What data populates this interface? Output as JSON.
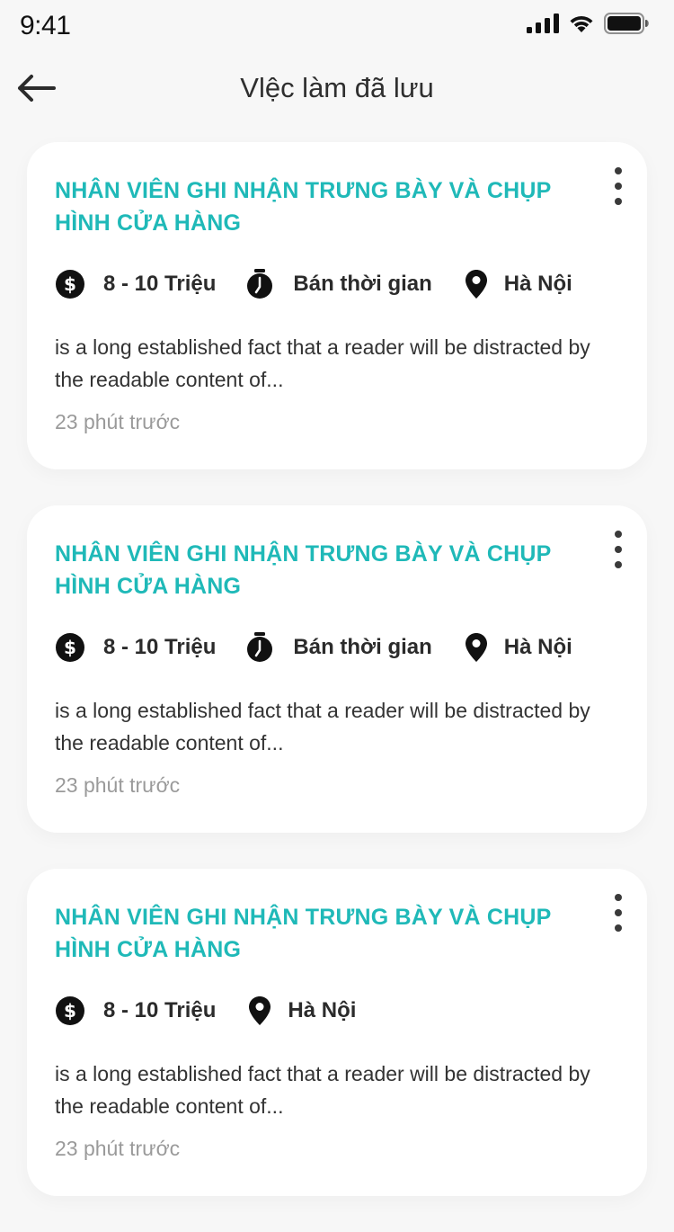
{
  "status_bar": {
    "time": "9:41"
  },
  "header": {
    "title": "Vlệc làm đã lưu"
  },
  "jobs": [
    {
      "title": "NHÂN VIÊN GHI NHẬN TRƯNG BÀY VÀ CHỤP HÌNH CỬA HÀNG",
      "salary": "8 - 10 Triệu",
      "job_type": "Bán thời gian",
      "location": "Hà Nội",
      "description": "is a long established fact that a reader will be distracted by the readable content of...",
      "posted": "23 phút trước"
    },
    {
      "title": "NHÂN VIÊN GHI NHẬN TRƯNG BÀY VÀ CHỤP HÌNH CỬA HÀNG",
      "salary": "8 - 10 Triệu",
      "job_type": "Bán thời gian",
      "location": "Hà Nội",
      "description": "is a long established fact that a reader will be distracted by the readable content of...",
      "posted": "23 phút trước"
    },
    {
      "title": "NHÂN VIÊN GHI NHẬN TRƯNG BÀY VÀ CHỤP HÌNH CỬA HÀNG",
      "salary": "8 - 10 Triệu",
      "location": "Hà Nội",
      "description": "is a long established fact that a reader will be distracted by the readable content of...",
      "posted": "23 phút trước"
    }
  ],
  "icons": {
    "back": "arrow-left-icon",
    "more": "more-vertical-icon",
    "salary": "dollar-circle-icon",
    "job_type": "stopwatch-icon",
    "location": "map-pin-icon",
    "signal": "cellular-signal-icon",
    "wifi": "wifi-icon",
    "battery": "battery-icon"
  },
  "colors": {
    "accent": "#1fb9b8",
    "background": "#f7f7f7",
    "card": "#ffffff",
    "muted_text": "#9a9a9a"
  }
}
